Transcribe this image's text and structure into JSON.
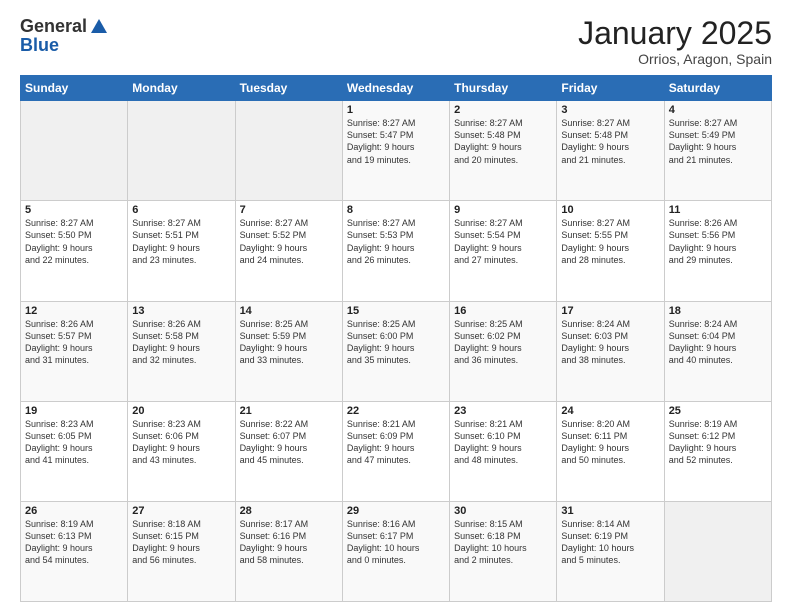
{
  "logo": {
    "general": "General",
    "blue": "Blue"
  },
  "title": "January 2025",
  "location": "Orrios, Aragon, Spain",
  "days_header": [
    "Sunday",
    "Monday",
    "Tuesday",
    "Wednesday",
    "Thursday",
    "Friday",
    "Saturday"
  ],
  "weeks": [
    [
      {
        "day": "",
        "info": ""
      },
      {
        "day": "",
        "info": ""
      },
      {
        "day": "",
        "info": ""
      },
      {
        "day": "1",
        "info": "Sunrise: 8:27 AM\nSunset: 5:47 PM\nDaylight: 9 hours\nand 19 minutes."
      },
      {
        "day": "2",
        "info": "Sunrise: 8:27 AM\nSunset: 5:48 PM\nDaylight: 9 hours\nand 20 minutes."
      },
      {
        "day": "3",
        "info": "Sunrise: 8:27 AM\nSunset: 5:48 PM\nDaylight: 9 hours\nand 21 minutes."
      },
      {
        "day": "4",
        "info": "Sunrise: 8:27 AM\nSunset: 5:49 PM\nDaylight: 9 hours\nand 21 minutes."
      }
    ],
    [
      {
        "day": "5",
        "info": "Sunrise: 8:27 AM\nSunset: 5:50 PM\nDaylight: 9 hours\nand 22 minutes."
      },
      {
        "day": "6",
        "info": "Sunrise: 8:27 AM\nSunset: 5:51 PM\nDaylight: 9 hours\nand 23 minutes."
      },
      {
        "day": "7",
        "info": "Sunrise: 8:27 AM\nSunset: 5:52 PM\nDaylight: 9 hours\nand 24 minutes."
      },
      {
        "day": "8",
        "info": "Sunrise: 8:27 AM\nSunset: 5:53 PM\nDaylight: 9 hours\nand 26 minutes."
      },
      {
        "day": "9",
        "info": "Sunrise: 8:27 AM\nSunset: 5:54 PM\nDaylight: 9 hours\nand 27 minutes."
      },
      {
        "day": "10",
        "info": "Sunrise: 8:27 AM\nSunset: 5:55 PM\nDaylight: 9 hours\nand 28 minutes."
      },
      {
        "day": "11",
        "info": "Sunrise: 8:26 AM\nSunset: 5:56 PM\nDaylight: 9 hours\nand 29 minutes."
      }
    ],
    [
      {
        "day": "12",
        "info": "Sunrise: 8:26 AM\nSunset: 5:57 PM\nDaylight: 9 hours\nand 31 minutes."
      },
      {
        "day": "13",
        "info": "Sunrise: 8:26 AM\nSunset: 5:58 PM\nDaylight: 9 hours\nand 32 minutes."
      },
      {
        "day": "14",
        "info": "Sunrise: 8:25 AM\nSunset: 5:59 PM\nDaylight: 9 hours\nand 33 minutes."
      },
      {
        "day": "15",
        "info": "Sunrise: 8:25 AM\nSunset: 6:00 PM\nDaylight: 9 hours\nand 35 minutes."
      },
      {
        "day": "16",
        "info": "Sunrise: 8:25 AM\nSunset: 6:02 PM\nDaylight: 9 hours\nand 36 minutes."
      },
      {
        "day": "17",
        "info": "Sunrise: 8:24 AM\nSunset: 6:03 PM\nDaylight: 9 hours\nand 38 minutes."
      },
      {
        "day": "18",
        "info": "Sunrise: 8:24 AM\nSunset: 6:04 PM\nDaylight: 9 hours\nand 40 minutes."
      }
    ],
    [
      {
        "day": "19",
        "info": "Sunrise: 8:23 AM\nSunset: 6:05 PM\nDaylight: 9 hours\nand 41 minutes."
      },
      {
        "day": "20",
        "info": "Sunrise: 8:23 AM\nSunset: 6:06 PM\nDaylight: 9 hours\nand 43 minutes."
      },
      {
        "day": "21",
        "info": "Sunrise: 8:22 AM\nSunset: 6:07 PM\nDaylight: 9 hours\nand 45 minutes."
      },
      {
        "day": "22",
        "info": "Sunrise: 8:21 AM\nSunset: 6:09 PM\nDaylight: 9 hours\nand 47 minutes."
      },
      {
        "day": "23",
        "info": "Sunrise: 8:21 AM\nSunset: 6:10 PM\nDaylight: 9 hours\nand 48 minutes."
      },
      {
        "day": "24",
        "info": "Sunrise: 8:20 AM\nSunset: 6:11 PM\nDaylight: 9 hours\nand 50 minutes."
      },
      {
        "day": "25",
        "info": "Sunrise: 8:19 AM\nSunset: 6:12 PM\nDaylight: 9 hours\nand 52 minutes."
      }
    ],
    [
      {
        "day": "26",
        "info": "Sunrise: 8:19 AM\nSunset: 6:13 PM\nDaylight: 9 hours\nand 54 minutes."
      },
      {
        "day": "27",
        "info": "Sunrise: 8:18 AM\nSunset: 6:15 PM\nDaylight: 9 hours\nand 56 minutes."
      },
      {
        "day": "28",
        "info": "Sunrise: 8:17 AM\nSunset: 6:16 PM\nDaylight: 9 hours\nand 58 minutes."
      },
      {
        "day": "29",
        "info": "Sunrise: 8:16 AM\nSunset: 6:17 PM\nDaylight: 10 hours\nand 0 minutes."
      },
      {
        "day": "30",
        "info": "Sunrise: 8:15 AM\nSunset: 6:18 PM\nDaylight: 10 hours\nand 2 minutes."
      },
      {
        "day": "31",
        "info": "Sunrise: 8:14 AM\nSunset: 6:19 PM\nDaylight: 10 hours\nand 5 minutes."
      },
      {
        "day": "",
        "info": ""
      }
    ]
  ]
}
